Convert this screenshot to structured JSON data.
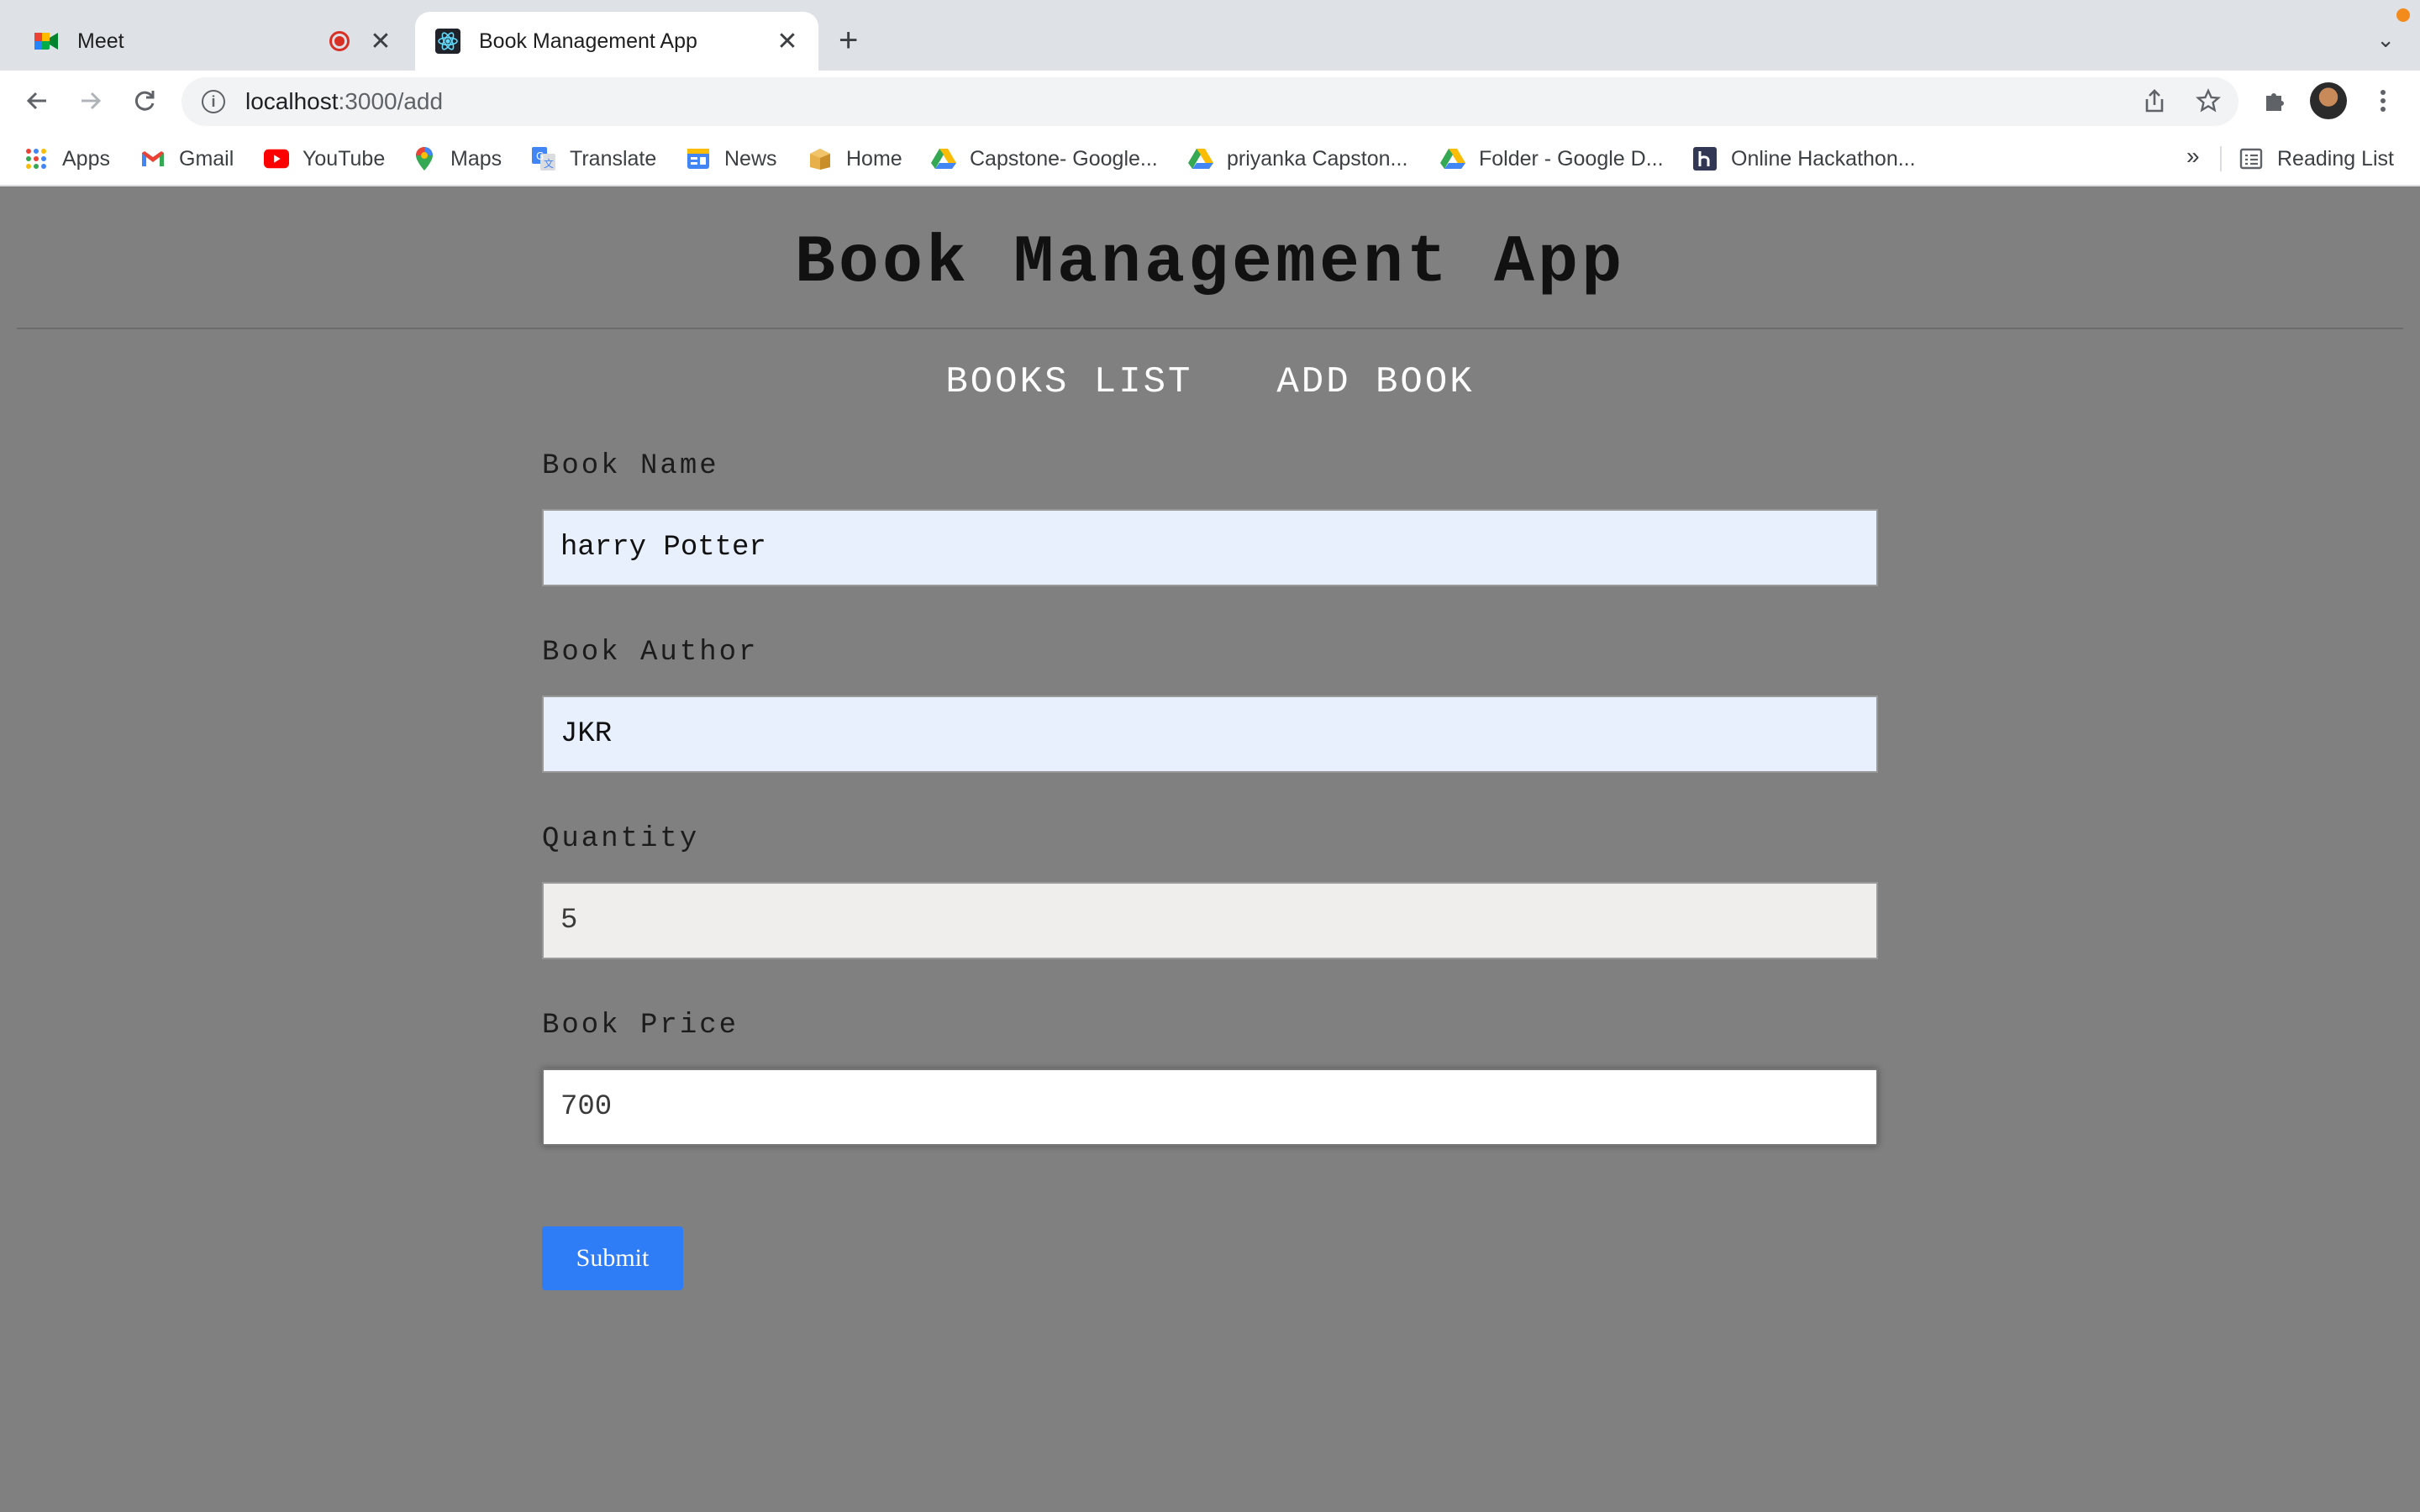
{
  "browser": {
    "tabs": [
      {
        "title": "Meet",
        "icon": "google-meet-icon",
        "active": false,
        "recording": true
      },
      {
        "title": "Book Management App",
        "icon": "react-icon",
        "active": true
      }
    ],
    "address": {
      "host": "localhost",
      "path": ":3000/add"
    },
    "bookmarks": [
      {
        "label": "Apps",
        "icon": "apps-grid-icon"
      },
      {
        "label": "Gmail",
        "icon": "gmail-icon"
      },
      {
        "label": "YouTube",
        "icon": "youtube-icon"
      },
      {
        "label": "Maps",
        "icon": "maps-pin-icon"
      },
      {
        "label": "Translate",
        "icon": "translate-icon"
      },
      {
        "label": "News",
        "icon": "news-icon"
      },
      {
        "label": "Home",
        "icon": "home-box-icon"
      },
      {
        "label": "Capstone- Google...",
        "icon": "google-drive-icon"
      },
      {
        "label": "priyanka Capston...",
        "icon": "google-drive-icon"
      },
      {
        "label": "Folder - Google D...",
        "icon": "google-drive-icon"
      },
      {
        "label": "Online Hackathon...",
        "icon": "hackerearth-icon"
      }
    ],
    "more_bookmarks": "»",
    "reading_list": "Reading List"
  },
  "page": {
    "title": "Book Management App",
    "nav": {
      "books_list": "BOOKS LIST",
      "add_book": "ADD BOOK"
    },
    "form": {
      "book_name": {
        "label": "Book Name",
        "value": "harry Potter"
      },
      "book_author": {
        "label": "Book Author",
        "value": "JKR"
      },
      "quantity": {
        "label": "Quantity",
        "value": "5"
      },
      "book_price": {
        "label": "Book Price",
        "value": "700"
      },
      "submit_label": "Submit"
    }
  },
  "colors": {
    "page_background": "#808080",
    "autofill_field": "#e8f0fe",
    "submit_button": "#2f7df6"
  }
}
